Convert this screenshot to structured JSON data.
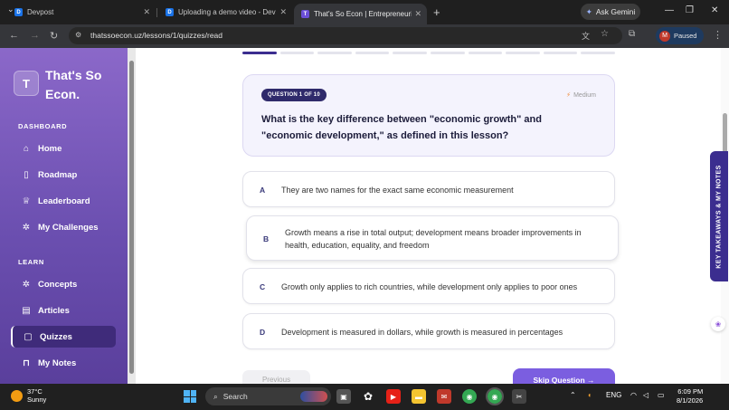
{
  "browser": {
    "tabs": [
      {
        "title": "Devpost",
        "favicon": "D"
      },
      {
        "title": "Uploading a demo video - Devp",
        "favicon": "D"
      },
      {
        "title": "That's So Econ | Entrepreneuria",
        "favicon": "T"
      }
    ],
    "new_tab": "+",
    "gemini_label": "Ask Gemini",
    "url": "thatssoecon.uz/lessons/1/quizzes/read",
    "profile_initial": "M",
    "profile_status": "Paused"
  },
  "sidebar": {
    "logo_letter": "T",
    "brand": "That's So Econ.",
    "sections": [
      {
        "label": "DASHBOARD",
        "items": [
          {
            "label": "Home",
            "icon": "home-icon"
          },
          {
            "label": "Roadmap",
            "icon": "map-icon"
          },
          {
            "label": "Leaderboard",
            "icon": "trophy-icon"
          },
          {
            "label": "My Challenges",
            "icon": "sparkle-icon"
          }
        ]
      },
      {
        "label": "LEARN",
        "items": [
          {
            "label": "Concepts",
            "icon": "bulb-icon"
          },
          {
            "label": "Articles",
            "icon": "article-icon"
          },
          {
            "label": "Quizzes",
            "icon": "quiz-icon",
            "active": true
          },
          {
            "label": "My Notes",
            "icon": "bookmark-icon"
          }
        ]
      }
    ]
  },
  "quiz": {
    "progress": {
      "current": 1,
      "total": 10
    },
    "badge": "QUESTION 1 OF 10",
    "difficulty": "Medium",
    "question": "What is the key difference between \"economic growth\" and \"economic development,\" as defined in this lesson?",
    "options": [
      {
        "letter": "A",
        "text": "They are two names for the exact same economic measurement"
      },
      {
        "letter": "B",
        "text": "Growth means a rise in total output; development means broader improvements in health, education, equality, and freedom"
      },
      {
        "letter": "C",
        "text": "Growth only applies to rich countries, while development only applies to poor ones"
      },
      {
        "letter": "D",
        "text": "Development is measured in dollars, while growth is measured in percentages"
      }
    ],
    "previous_label": "Previous",
    "skip_label": "Skip Question →"
  },
  "side_tab": "KEY TAKEAWAYS & MY NOTES",
  "taskbar": {
    "temperature": "37°C",
    "weather": "Sunny",
    "search_placeholder": "Search",
    "language": "ENG",
    "time": "6:09 PM",
    "date": "8/1/2026"
  },
  "colors": {
    "accent": "#7b5ee0",
    "sidebar_active": "#3f2b7a",
    "badge": "#2f2a6b"
  }
}
